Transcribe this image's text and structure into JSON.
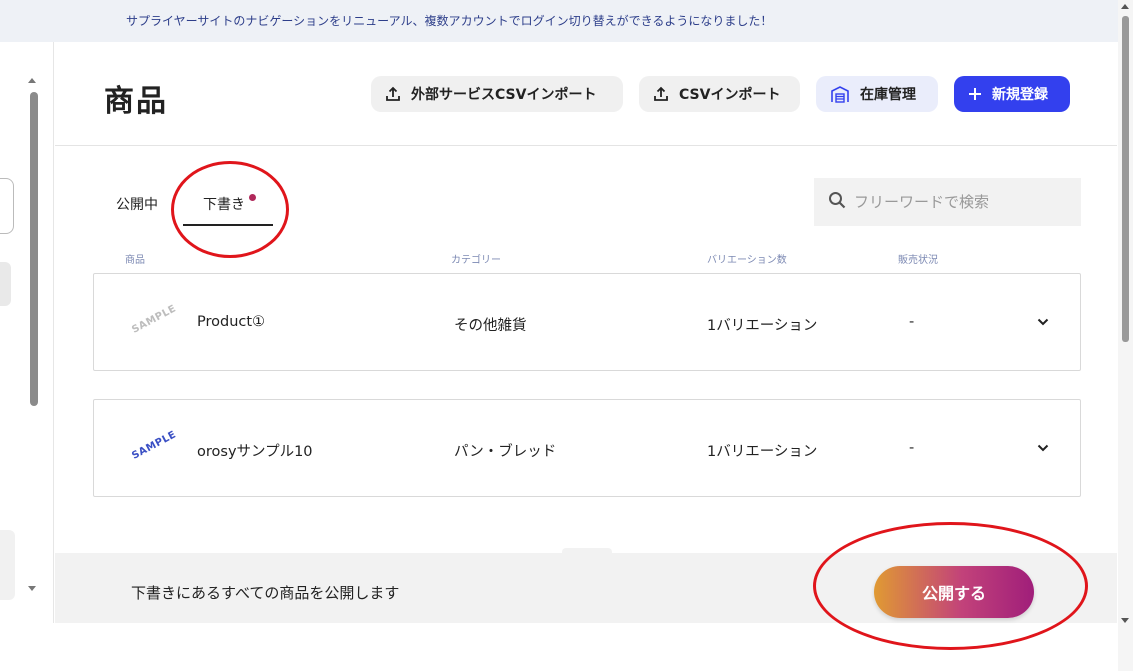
{
  "banner": {
    "text": "サプライヤーサイトのナビゲーションをリニューアル、複数アカウントでログイン切り替えができるようになりました！"
  },
  "page": {
    "title": "商品"
  },
  "toolbar": {
    "external_csv_import": "外部サービスCSVインポート",
    "csv_import": "CSVインポート",
    "inventory": "在庫管理",
    "new_register": "新規登録"
  },
  "tabs": [
    {
      "label": "公開中",
      "active": false
    },
    {
      "label": "下書き",
      "active": true,
      "has_notification_dot": true
    }
  ],
  "search": {
    "placeholder": "フリーワードで検索",
    "value": ""
  },
  "table": {
    "columns": [
      "商品",
      "カテゴリー",
      "バリエーション数",
      "販売状況"
    ],
    "rows": [
      {
        "thumbnail": "SAMPLE",
        "thumbnail_color": "#bdbdbd",
        "name": "Product①",
        "category": "その他雑貨",
        "variations": "1バリエーション",
        "status": "-"
      },
      {
        "thumbnail": "SAMPLE",
        "thumbnail_color": "#3a4fc4",
        "name": "orosyサンプル10",
        "category": "パン・ブレッド",
        "variations": "1バリエーション",
        "status": "-"
      }
    ]
  },
  "footer": {
    "message": "下書きにあるすべての商品を公開します",
    "publish_button": "公開する"
  },
  "colors": {
    "accent": "#3340ee",
    "notification_dot": "#b0285a",
    "publish_gradient_start": "#e09a33",
    "publish_gradient_end": "#a01e7a",
    "annotation": "#e0151b"
  },
  "icons": {
    "upload": "upload-icon",
    "warehouse": "warehouse-icon",
    "plus": "plus-icon",
    "search": "search-icon",
    "chevron": "chevron-down-icon"
  }
}
